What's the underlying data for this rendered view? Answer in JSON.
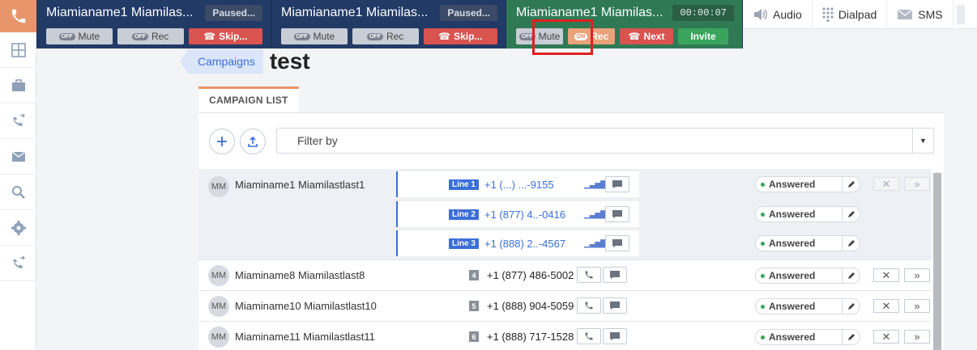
{
  "call_bar": [
    {
      "name": "Miamianame1 Miamilas...",
      "status": "Paused...",
      "mute": "Mute",
      "rec": "Rec",
      "rec_state": "OFF",
      "action": "Skip...",
      "mute_state": "OFF"
    },
    {
      "name": "Miamianame1 Miamilas...",
      "status": "Paused...",
      "mute": "Mute",
      "rec": "Rec",
      "rec_state": "OFF",
      "action": "Skip...",
      "mute_state": "OFF"
    },
    {
      "name": "Miamianame1 Miamilas...",
      "status": "00:00:07",
      "mute": "Mute",
      "rec": "Rec",
      "rec_state": "ON",
      "action": "Next",
      "invite": "Invite",
      "mute_state": "OFF"
    }
  ],
  "toolbar": {
    "audio": "Audio",
    "dialpad": "Dialpad",
    "sms": "SMS"
  },
  "breadcrumb": {
    "label": "Campaigns"
  },
  "page_title": "test",
  "tab": {
    "label": "CAMPAIGN LIST"
  },
  "filter": {
    "placeholder": "Filter by"
  },
  "contacts": [
    {
      "initials": "MM",
      "name": "Miaminame1 Miamilastlast1",
      "lines": [
        {
          "badge": "Line 1",
          "phone": "+1 (...) ...-9155",
          "status": "Answered"
        },
        {
          "badge": "Line 2",
          "phone": "+1 (877) 4..-0416",
          "status": "Answered"
        },
        {
          "badge": "Line 3",
          "phone": "+1 (888) 2..-4567",
          "status": "Answered"
        }
      ]
    },
    {
      "initials": "MM",
      "name": "Miaminame8 Miamilastlast8",
      "index": "4",
      "phone": "+1 (877) 486-5002",
      "status": "Answered"
    },
    {
      "initials": "MM",
      "name": "Miaminame10 Miamilastlast10",
      "index": "5",
      "phone": "+1 (888) 904-5059",
      "status": "Answered"
    },
    {
      "initials": "MM",
      "name": "Miaminame11 Miamilastlast11",
      "index": "6",
      "phone": "+1 (888) 717-1528",
      "status": "Answered"
    }
  ]
}
